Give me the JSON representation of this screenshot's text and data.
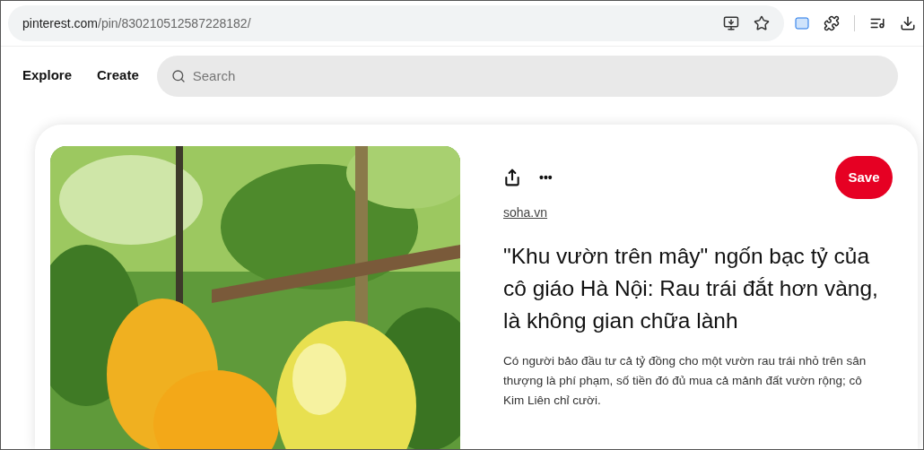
{
  "address_bar": {
    "domain": "pinterest.com",
    "path": "/pin/830210512587228182/"
  },
  "nav": {
    "links": [
      "Explore",
      "Create"
    ],
    "search": {
      "placeholder": "Search"
    }
  },
  "pin": {
    "save_button": "Save",
    "more_label": "•••",
    "source": "soha.vn",
    "title": "\"Khu vườn trên mây\" ngốn bạc tỷ của cô giáo Hà Nội: Rau trái đắt hơn vàng, là không gian chữa lành",
    "description": "Có người bảo đầu tư cả tỷ đồng cho một vườn rau trái nhỏ trên sân thượng là phí phạm, số tiền đó đủ mua cả mảnh đất vườn rộng; cô Kim Liên chỉ cười."
  }
}
